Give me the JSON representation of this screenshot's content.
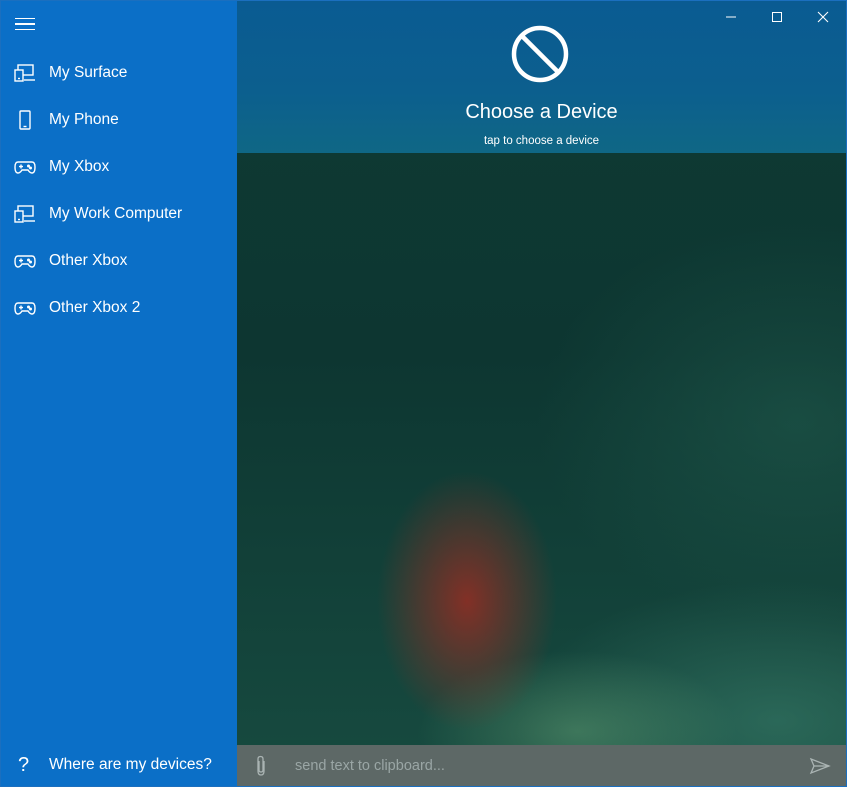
{
  "sidebar": {
    "menu_icon": "hamburger-icon",
    "items": [
      {
        "label": "My Surface",
        "icon": "laptop-icon"
      },
      {
        "label": "My Phone",
        "icon": "phone-icon"
      },
      {
        "label": "My Xbox",
        "icon": "gamepad-icon"
      },
      {
        "label": "My Work Computer",
        "icon": "laptop-icon"
      },
      {
        "label": "Other Xbox",
        "icon": "gamepad-icon"
      },
      {
        "label": "Other Xbox 2",
        "icon": "gamepad-icon"
      }
    ],
    "help": {
      "label": "Where are my devices?",
      "icon": "question-icon",
      "glyph": "?"
    }
  },
  "header": {
    "icon": "blocked-icon",
    "title": "Choose a Device",
    "subtitle": "tap to choose a device"
  },
  "window_controls": [
    "minimize-icon",
    "maximize-icon",
    "close-icon"
  ],
  "composer": {
    "placeholder": "send text to clipboard...",
    "value": "",
    "attach_icon": "paperclip-icon",
    "send_icon": "send-icon"
  },
  "colors": {
    "sidebar": "#0b6fc7",
    "header": "#0a5b92",
    "bottombar": "#5d6866"
  }
}
